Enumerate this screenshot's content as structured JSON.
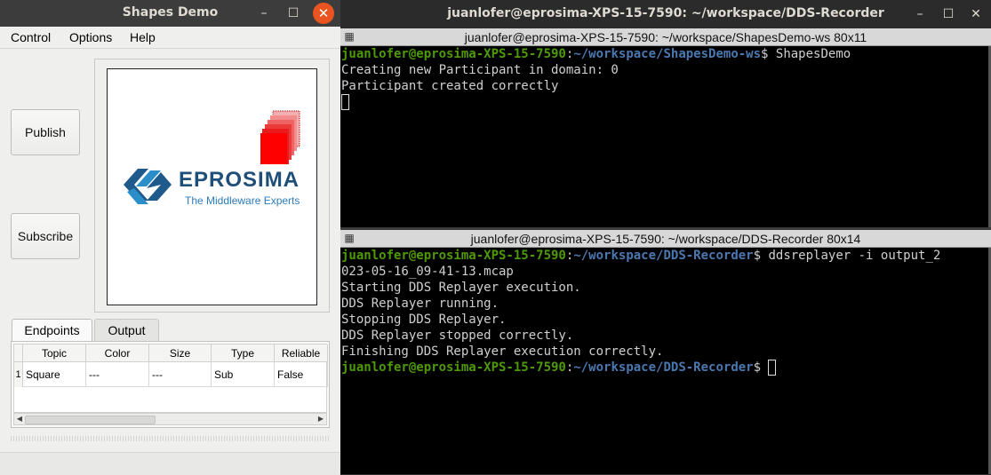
{
  "shapes_window": {
    "title": "Shapes Demo",
    "menu": [
      "Control",
      "Options",
      "Help"
    ],
    "publish_label": "Publish",
    "subscribe_label": "Subscribe",
    "logo": {
      "text": "EPROSIMA",
      "tagline": "The Middleware Experts",
      "brand_color": "#1f5a8c"
    },
    "tabs": [
      "Endpoints",
      "Output"
    ],
    "table": {
      "headers": [
        "Topic",
        "Color",
        "Size",
        "Type",
        "Reliable"
      ],
      "rows": [
        {
          "num": "1",
          "cells": [
            "Square",
            "---",
            "---",
            "Sub",
            "False"
          ]
        }
      ]
    }
  },
  "terminal_window": {
    "title": "juanlofer@eprosima-XPS-15-7590: ~/workspace/DDS-Recorder",
    "pane1": {
      "title": "juanlofer@eprosima-XPS-15-7590: ~/workspace/ShapesDemo-ws 80x11",
      "prompt_user": "juanlofer@eprosima-XPS-15-7590",
      "prompt_path": "~/workspace/ShapesDemo-ws",
      "command": "ShapesDemo",
      "output": [
        "Creating new Participant in domain: 0",
        "Participant created correctly"
      ]
    },
    "pane2": {
      "title": "juanlofer@eprosima-XPS-15-7590: ~/workspace/DDS-Recorder 80x14",
      "prompt_user": "juanlofer@eprosima-XPS-15-7590",
      "prompt_path": "~/workspace/DDS-Recorder",
      "command": "ddsreplayer -i output_2",
      "command_wrap": "023-05-16_09-41-13.mcap",
      "output": [
        "Starting DDS Replayer execution.",
        "DDS Replayer running.",
        "Stopping DDS Replayer.",
        "DDS Replayer stopped correctly.",
        "Finishing DDS Replayer execution correctly."
      ],
      "final_prompt_user": "juanlofer@eprosima-XPS-15-7590",
      "final_prompt_path": "~/workspace/DDS-Recorder"
    }
  },
  "colors": {
    "ubuntu_orange": "#e95420",
    "prompt_green": "#4e9a06",
    "prompt_blue": "#4a78b0"
  }
}
